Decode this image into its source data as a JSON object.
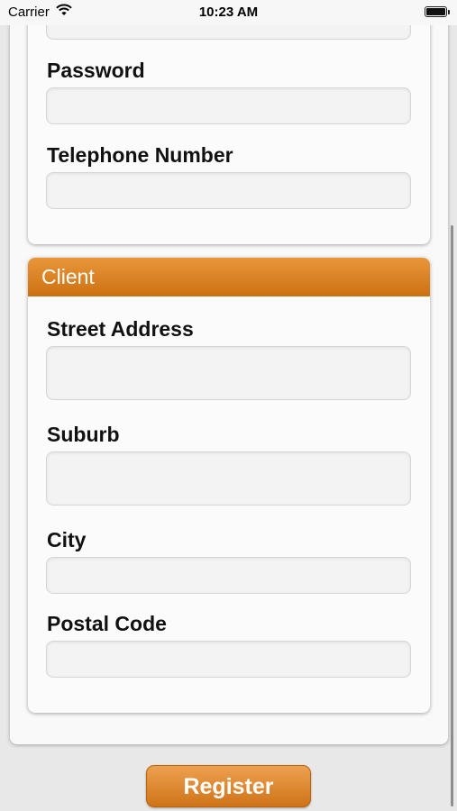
{
  "status_bar": {
    "carrier": "Carrier",
    "time": "10:23 AM"
  },
  "account": {
    "fields": [
      {
        "label": "Password",
        "value": ""
      },
      {
        "label": "Telephone Number",
        "value": ""
      }
    ]
  },
  "client": {
    "title": "Client",
    "fields": [
      {
        "label": "Street Address",
        "value": ""
      },
      {
        "label": "Suburb",
        "value": ""
      },
      {
        "label": "City",
        "value": ""
      },
      {
        "label": "Postal Code",
        "value": ""
      }
    ]
  },
  "register_label": "Register",
  "colors": {
    "accent": "#d97f20",
    "accent_dark": "#c46a10"
  }
}
